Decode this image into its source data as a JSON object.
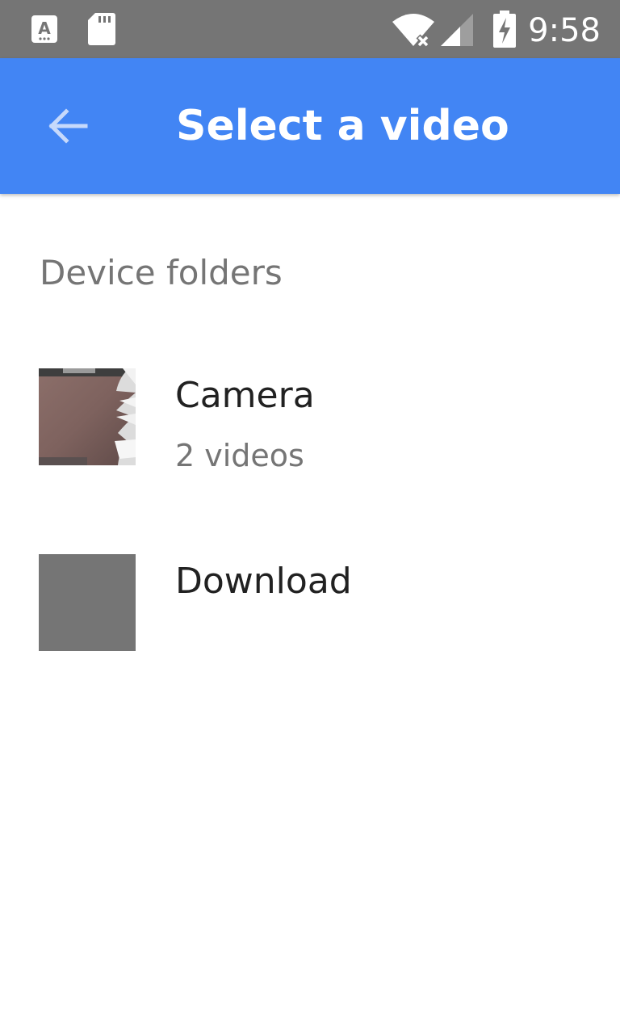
{
  "status_bar": {
    "time": "9:58",
    "background_color": "#757575",
    "icons": [
      "font-a-icon",
      "sd-card-icon",
      "wifi-no-internet-icon",
      "cell-signal-icon",
      "battery-charging-icon"
    ]
  },
  "app_bar": {
    "title": "Select a video",
    "background_color": "#4285f4",
    "back_icon": "arrow-back-icon"
  },
  "section": {
    "header": "Device folders"
  },
  "folders": [
    {
      "name": "Camera",
      "count": "2 videos",
      "thumbnail": "hand-photo"
    },
    {
      "name": "Download",
      "count": "",
      "thumbnail": "gray-placeholder"
    }
  ]
}
